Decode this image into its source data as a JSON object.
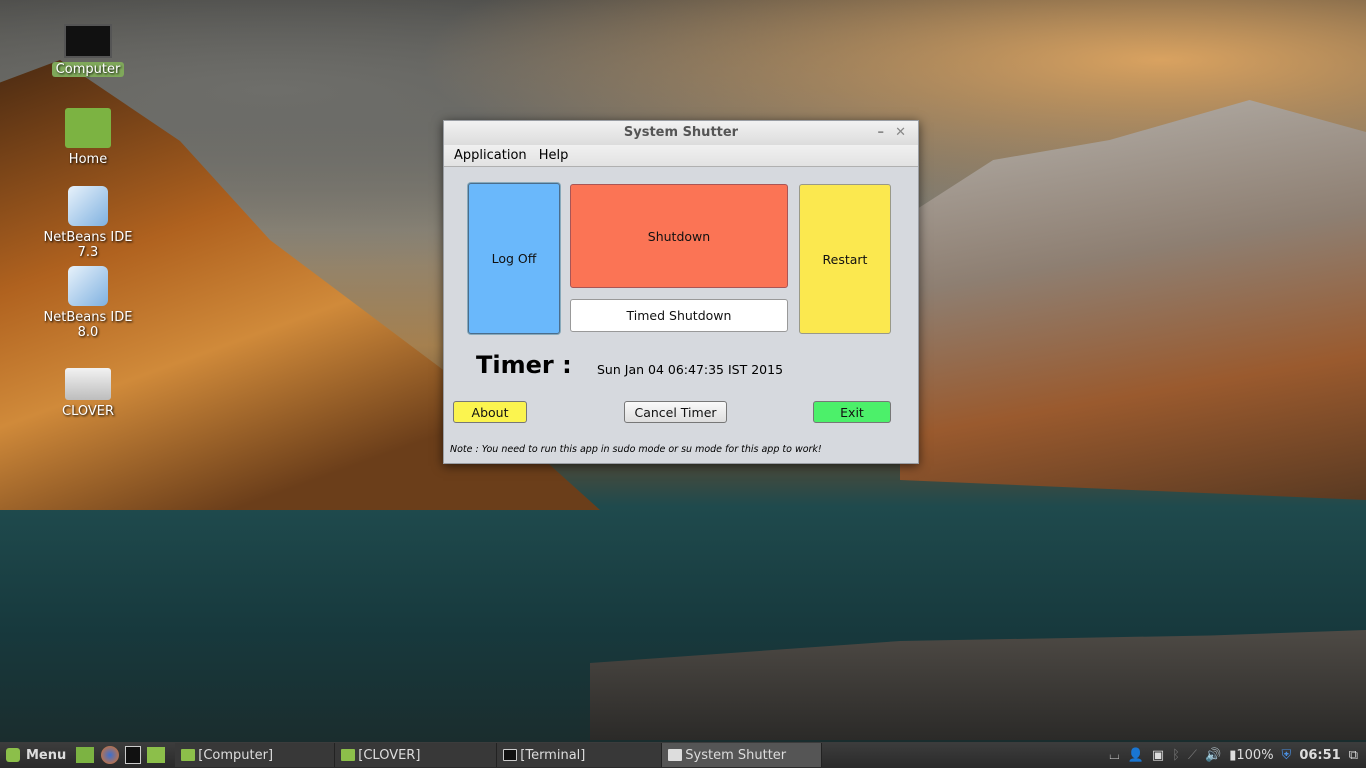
{
  "desktop": {
    "icons": [
      {
        "label": "Computer",
        "icon": "monitor-icon"
      },
      {
        "label": "Home",
        "icon": "home-folder-icon"
      },
      {
        "label": "NetBeans IDE 7.3",
        "icon": "netbeans-cube-icon"
      },
      {
        "label": "NetBeans IDE 8.0",
        "icon": "netbeans-cube-icon"
      },
      {
        "label": "CLOVER",
        "icon": "usb-drive-icon"
      }
    ]
  },
  "window": {
    "title": "System Shutter",
    "menu": [
      "Application",
      "Help"
    ],
    "buttons": {
      "log_off": "Log Off",
      "shutdown": "Shutdown",
      "timed_shutdown": "Timed Shutdown",
      "restart": "Restart",
      "about": "About",
      "cancel_timer": "Cancel Timer",
      "exit": "Exit"
    },
    "timer_label": "Timer :",
    "timer_value": "Sun Jan 04 06:47:35 IST 2015",
    "note": "Note : You need to run this app in sudo mode or su mode for this app to work!",
    "colors": {
      "log_off": "#6ab8fb",
      "shutdown": "#fb7455",
      "restart": "#fbe84f",
      "about": "#fbf44f",
      "exit": "#4cf06a"
    }
  },
  "taskbar": {
    "menu_label": "Menu",
    "windows": [
      "[Computer]",
      "[CLOVER]",
      "[Terminal]",
      "System Shutter"
    ],
    "battery": "100%",
    "clock": "06:51"
  }
}
